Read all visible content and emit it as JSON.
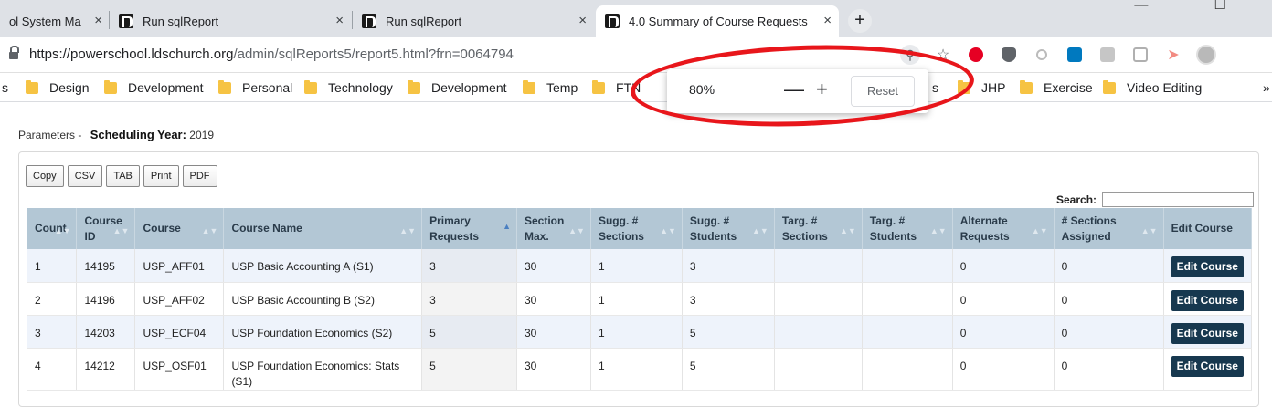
{
  "browser": {
    "tabs": [
      {
        "title": "ol System Ma",
        "active": false
      },
      {
        "title": "Run sqlReport",
        "active": false
      },
      {
        "title": "Run sqlReport",
        "active": false
      },
      {
        "title": "4.0 Summary of Course Requests",
        "active": true
      }
    ],
    "close_glyph": "×",
    "new_tab_glyph": "+",
    "url_host": "https://powerschool.ldschurch.org",
    "url_path": "/admin/sqlReports5/report5.html?frn=0064794",
    "bookmarks": [
      "Design",
      "Development",
      "Personal",
      "Technology",
      "Development",
      "Temp",
      "FTN",
      "s",
      "JHP",
      "Exercise",
      "Video Editing"
    ],
    "bookmark_left_fragment": "s",
    "overflow_glyph": "»",
    "zoom_popup": {
      "value": "80%",
      "minus": "—",
      "plus": "+",
      "reset_label": "Reset"
    },
    "colors": {
      "highlight_ring": "#e8161b",
      "folder": "#f6c343"
    }
  },
  "page": {
    "parameters_label": "Parameters -",
    "scheduling_year_label": "Scheduling Year:",
    "scheduling_year_value": "2019",
    "export_buttons": [
      "Copy",
      "CSV",
      "TAB",
      "Print",
      "PDF"
    ],
    "search_label": "Search:",
    "search_value": "",
    "table": {
      "headers": [
        "Count",
        "Course ID",
        "Course",
        "Course Name",
        "Primary Requests",
        "Section Max.",
        "Sugg. # Sections",
        "Sugg. # Students",
        "Targ. # Sections",
        "Targ. # Students",
        "Alternate Requests",
        "# Sections Assigned",
        "Edit Course"
      ],
      "sorted_column": "Primary Requests",
      "rows": [
        [
          "1",
          "14195",
          "USP_AFF01",
          "USP Basic Accounting A (S1)",
          "3",
          "30",
          "1",
          "3",
          "",
          "",
          "0",
          "0",
          "Edit Course"
        ],
        [
          "2",
          "14196",
          "USP_AFF02",
          "USP Basic Accounting B (S2)",
          "3",
          "30",
          "1",
          "3",
          "",
          "",
          "0",
          "0",
          "Edit Course"
        ],
        [
          "3",
          "14203",
          "USP_ECF04",
          "USP Foundation Economics (S2)",
          "5",
          "30",
          "1",
          "5",
          "",
          "",
          "0",
          "0",
          "Edit Course"
        ],
        [
          "4",
          "14212",
          "USP_OSF01",
          "USP Foundation Economics: Stats (S1)",
          "5",
          "30",
          "1",
          "5",
          "",
          "",
          "0",
          "0",
          "Edit Course"
        ]
      ]
    }
  }
}
